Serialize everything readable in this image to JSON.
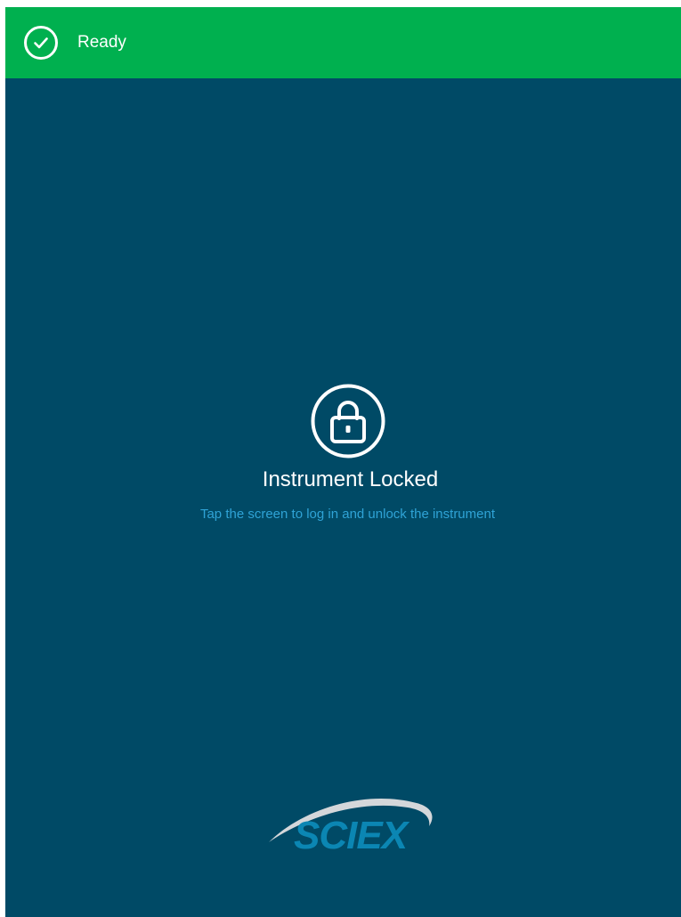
{
  "status": {
    "icon": "check-circle-icon",
    "text": "Ready",
    "color": "#00b04f"
  },
  "lock_screen": {
    "icon": "padlock-icon",
    "title": "Instrument Locked",
    "hint": "Tap the screen to log in and unlock the instrument",
    "background": "#004a66",
    "hint_color": "#2fa3d6"
  },
  "brand": {
    "logo_text": "SCIEX",
    "logo_color": "#0b86b3"
  }
}
